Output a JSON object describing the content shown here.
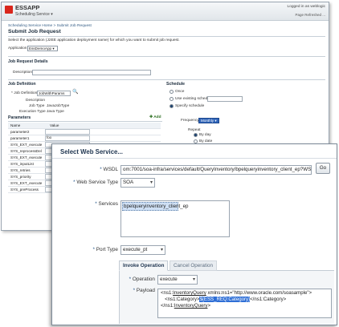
{
  "back_window": {
    "app_title": "ESSAPP",
    "app_menu": "Scheduling Service",
    "logged_in": "Logged in as weblogic",
    "refreshed": "Page Refreshed ...",
    "breadcrumb": "Scheduling Service Home > Submit Job Request",
    "page_title": "Submit Job Request",
    "instruction": "Select the application (J2EE application deployment name) for which you want to submit job request.",
    "application_label": "Application",
    "application_value": "EssDemoApp",
    "job_request_details": "Job Request Details",
    "description_label": "Description",
    "job_definition_section": "Job Definition",
    "job_definition_label": "* Job Definition",
    "job_definition_value": "JobWithParams",
    "description2_label": "Description",
    "job_type_label": "Job Type",
    "job_type_value": "JavaJobType",
    "execution_type_label": "Execution Type",
    "execution_type_value": "Java Type",
    "parameters_label": "Parameters",
    "add_label": "Add",
    "col_name": "Name",
    "col_value": "Value",
    "params": [
      {
        "name": "parameter2",
        "value": ""
      },
      {
        "name": "parameter1",
        "value": "foo"
      },
      {
        "name": "SYS_EXT_execute",
        "value": ""
      },
      {
        "name": "SYS_reprocessDel",
        "value": ""
      },
      {
        "name": "SYS_EXT_execute",
        "value": ""
      },
      {
        "name": "SYS_inputList",
        "value": ""
      },
      {
        "name": "SYS_retries",
        "value": ""
      },
      {
        "name": "SYS_priority",
        "value": ""
      },
      {
        "name": "SYS_EXT_execute",
        "value": ""
      },
      {
        "name": "SYS_preProcess",
        "value": ""
      }
    ],
    "schedule_section": "Schedule",
    "once_label": "Once",
    "use_existing_label": "Use existing schedule",
    "specify_label": "Specify schedule",
    "frequency_label": "Frequency",
    "frequency_value": "Monthly",
    "repeat_label": "Repeat",
    "by_day_label": "By day",
    "by_date_label": "By date"
  },
  "dialog": {
    "title": "Select Web Service...",
    "wsdl_label": "WSDL",
    "wsdl_value": "om:7001/soa-infra/services/default/QueryInventory/bpelqueryinventory_client_ep?WSDL",
    "go_label": "Go",
    "service_type_label": "Web Service Type",
    "service_type_value": "SOA",
    "services_label": "Services",
    "service_item": "bpelqueryinventory_client_ep",
    "port_type_label": "Port Type",
    "port_type_value": "execute_pt",
    "tab_invoke": "Invoke Operation",
    "tab_cancel": "Cancel Operation",
    "operation_label": "Operation",
    "operation_value": "execute",
    "payload_label": "Payload",
    "payload_line1_a": "<ns1:",
    "payload_line1_b": "InventoryQuery",
    "payload_line1_c": " xmlns:ns1=\"http://www.oracle.com/soasample\">",
    "payload_line2_a": "  <ns1:Category>",
    "payload_line2_b": "${ESS_REQ:Category}",
    "payload_line2_c": "</ns1:Category>",
    "payload_line3_a": "</ns1:",
    "payload_line3_b": "InventoryQuery",
    "payload_line3_c": ">"
  }
}
